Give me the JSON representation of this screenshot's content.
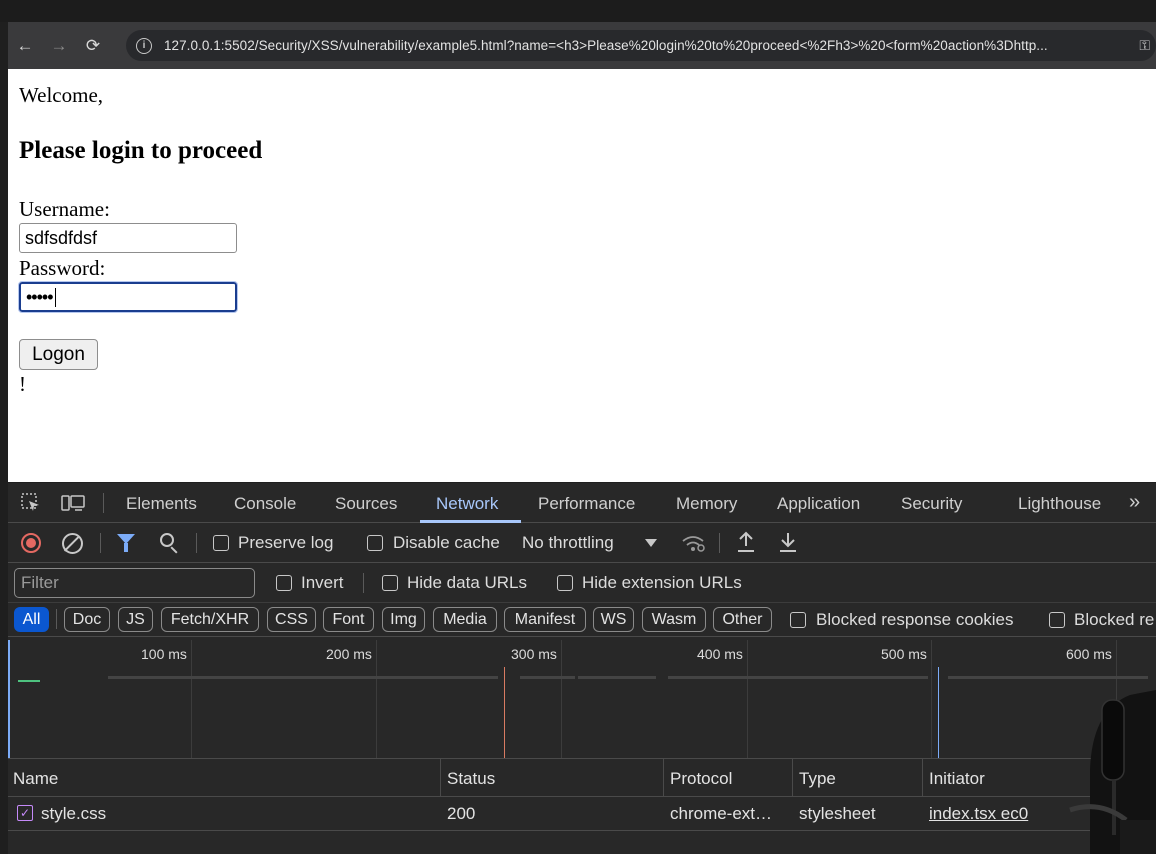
{
  "browser": {
    "url": "127.0.0.1:5502/Security/XSS/vulnerability/example5.html?name=<h3>Please%20login%20to%20proceed<%2Fh3>%20<form%20action%3Dhttp...",
    "back_icon": "←",
    "forward_icon": "→",
    "reload_icon": "⟳",
    "info_icon": "i",
    "key_icon": "⚿"
  },
  "page": {
    "welcome": "Welcome,",
    "heading": "Please login to proceed",
    "username_label": "Username:",
    "username_value": "sdfsdfdsf",
    "password_label": "Password:",
    "password_value": "•••••",
    "logon_label": "Logon",
    "exclamation": "!"
  },
  "devtools": {
    "tabs": [
      "Elements",
      "Console",
      "Sources",
      "Network",
      "Performance",
      "Memory",
      "Application",
      "Security",
      "Lighthouse"
    ],
    "active_tab": "Network",
    "more_icon": "»",
    "toolbar": {
      "preserve_log": "Preserve log",
      "disable_cache": "Disable cache",
      "throttling": "No throttling"
    },
    "filter_bar": {
      "placeholder": "Filter",
      "invert": "Invert",
      "hide_data_urls": "Hide data URLs",
      "hide_extension_urls": "Hide extension URLs"
    },
    "type_filters": [
      "All",
      "Doc",
      "JS",
      "Fetch/XHR",
      "CSS",
      "Font",
      "Img",
      "Media",
      "Manifest",
      "WS",
      "Wasm",
      "Other"
    ],
    "blocked_response_cookies": "Blocked response cookies",
    "blocked_requests": "Blocked re",
    "timeline_ticks": [
      "100 ms",
      "200 ms",
      "300 ms",
      "400 ms",
      "500 ms",
      "600 ms"
    ],
    "columns": [
      "Name",
      "Status",
      "Protocol",
      "Type",
      "Initiator"
    ],
    "rows": [
      {
        "name": "style.css",
        "status": "200",
        "protocol": "chrome-ext…",
        "type": "stylesheet",
        "initiator": "index.tsx  ec0"
      }
    ]
  }
}
